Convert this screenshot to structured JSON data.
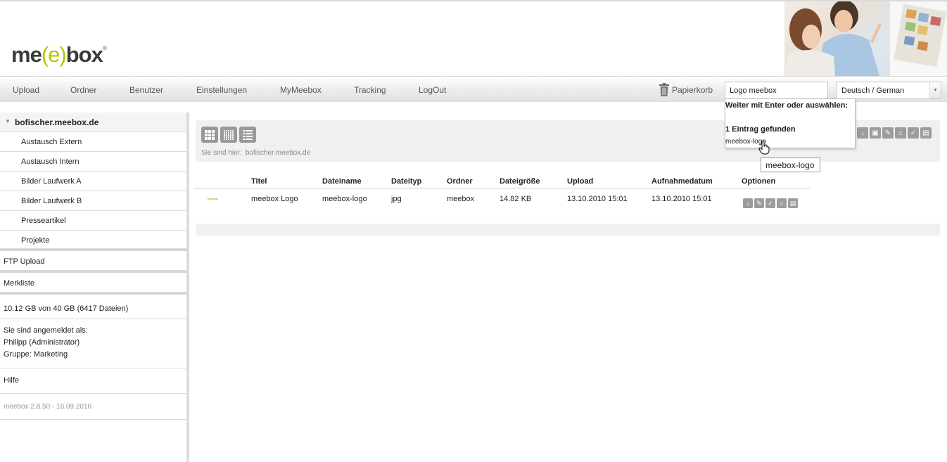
{
  "brand": {
    "logo_left": "me",
    "logo_bracket": "(e)",
    "logo_right": "box",
    "logo_reg": "®",
    "accent": "#b7c400"
  },
  "nav": {
    "items": [
      "Upload",
      "Ordner",
      "Benutzer",
      "Einstellungen",
      "MyMeebox",
      "Tracking",
      "LogOut"
    ],
    "trash_label": "Papierkorb",
    "search_value": "Logo meebox",
    "language": "Deutsch / German"
  },
  "autocomplete": {
    "hint": "Weiter mit Enter oder auswählen:",
    "count": "1 Eintrag gefunden",
    "result": "meebox-logo",
    "tooltip": "meebox-logo"
  },
  "sidebar": {
    "root": "bofischer.meebox.de",
    "folders": [
      "Austausch Extern",
      "Austausch Intern",
      "Bilder Laufwerk A",
      "Bilder Laufwerk B",
      "Presseartikel",
      "Projekte"
    ],
    "ftp": "FTP Upload",
    "merkliste": "Merkliste",
    "storage": "10.12 GB von 40 GB (6417 Dateien)",
    "login_label": "Sie sind angemeldet als:",
    "login_user": "Philipp (Administrator)",
    "login_group": "Gruppe: Marketing",
    "help": "Hilfe",
    "version": "meebox 2.8.50 - 16.09.2016"
  },
  "toolbar": {
    "breadcrumb_label": "Sie sind hier:",
    "breadcrumb_path": "bofischer.meebox.de"
  },
  "table": {
    "headers": [
      "Titel",
      "Dateiname",
      "Dateityp",
      "Ordner",
      "Dateigröße",
      "Upload",
      "Aufnahmedatum",
      "Optionen"
    ],
    "rows": [
      {
        "thumb": "meebox",
        "titel": "meebox Logo",
        "dateiname": "meebox-logo",
        "dateityp": "jpg",
        "ordner": "meebox",
        "groesse": "14.82 KB",
        "upload": "13.10.2010 15:01",
        "aufnahme": "13.10.2010 15:01"
      }
    ]
  }
}
